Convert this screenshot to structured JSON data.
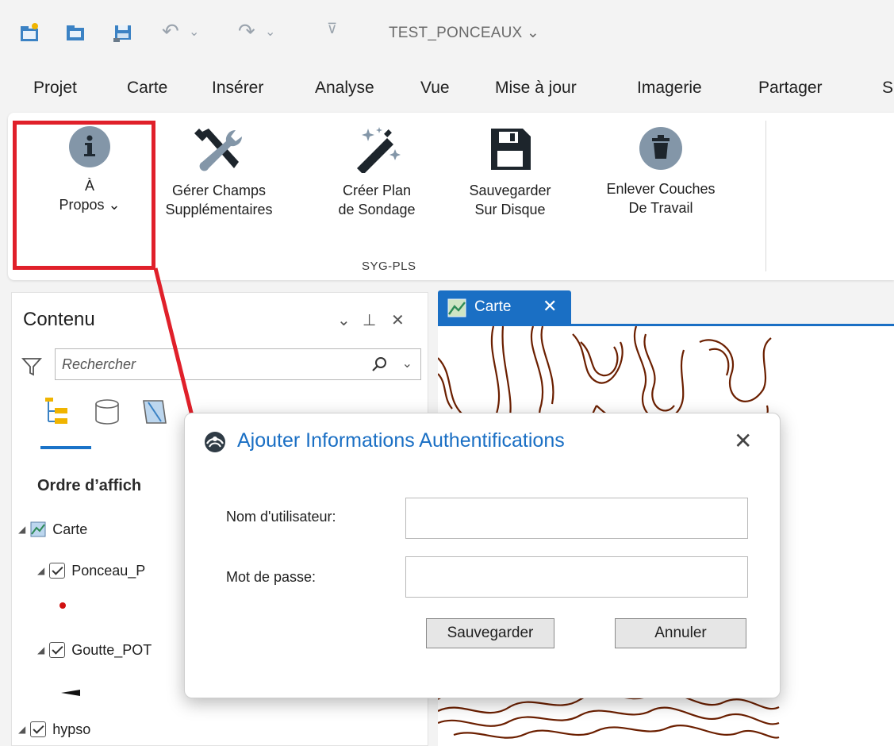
{
  "quick_access": {
    "title": "TEST_PONCEAUX",
    "title_caret": "⌄",
    "icons": [
      "new-project-icon",
      "open-project-icon",
      "save-project-icon",
      "undo-icon",
      "redo-icon",
      "customize-toolbar-icon"
    ]
  },
  "ribbon_tabs": [
    "Projet",
    "Carte",
    "Insérer",
    "Analyse",
    "Vue",
    "Mise à jour",
    "Imagerie",
    "Partager",
    "S"
  ],
  "ribbon": {
    "group_label": "SYG-PLS",
    "buttons": [
      {
        "label": "À\nPropos ⌄",
        "icon": "info-icon"
      },
      {
        "label": "Gérer Champs\nSupplémentaires",
        "icon": "tools-icon"
      },
      {
        "label": "Créer Plan\nde Sondage",
        "icon": "magic-wand-icon"
      },
      {
        "label": "Sauvegarder\nSur Disque",
        "icon": "floppy-disk-icon"
      },
      {
        "label": "Enlever Couches\nDe Travail",
        "icon": "trash-icon"
      }
    ],
    "highlight_color": "#e0202a"
  },
  "contents_pane": {
    "title": "Contenu",
    "controls": [
      "⌄",
      "⊥",
      "✕"
    ],
    "search_placeholder": "Rechercher",
    "draw_order_label": "Ordre d’affich",
    "tree": [
      {
        "label": "Carte",
        "type": "map"
      },
      {
        "label": "Ponceau_P",
        "type": "layer"
      },
      {
        "label": "Goutte_POT",
        "type": "layer"
      },
      {
        "label": "hypso",
        "type": "layer"
      }
    ]
  },
  "map_tab": {
    "label": "Carte",
    "close": "✕",
    "accent": "#1a6fc4",
    "contour_color": "#6b1f00"
  },
  "dialog": {
    "title": "Ajouter Informations Authentifications",
    "close": "✕",
    "username_label": "Nom d'utilisateur:",
    "username_value": "",
    "password_label": "Mot de passe:",
    "password_value": "",
    "save_label": "Sauvegarder",
    "cancel_label": "Annuler"
  }
}
